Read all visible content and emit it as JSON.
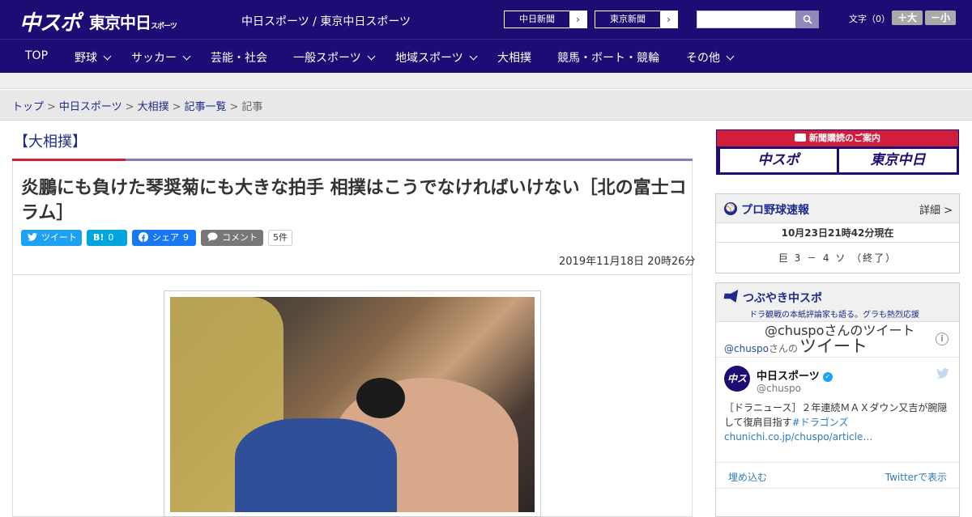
{
  "header": {
    "logo_chuspo": "中スポ",
    "logo_tokyo": "東京中日",
    "logo_tokyo_small": "スポーツ",
    "site_title": "中日スポーツ / 東京中日スポーツ",
    "paper_buttons": [
      "中日新聞",
      "東京新聞"
    ],
    "font_size_label": "文字（0）",
    "font_larger": "＋大",
    "font_smaller": "－小"
  },
  "nav": {
    "items": [
      {
        "label": "TOP",
        "dropdown": false
      },
      {
        "label": "野球",
        "dropdown": true
      },
      {
        "label": "サッカー",
        "dropdown": true
      },
      {
        "label": "芸能・社会",
        "dropdown": false
      },
      {
        "label": "一般スポーツ",
        "dropdown": true
      },
      {
        "label": "地域スポーツ",
        "dropdown": true
      },
      {
        "label": "大相撲",
        "dropdown": false
      },
      {
        "label": "競馬・ボート・競輪",
        "dropdown": false
      },
      {
        "label": "その他",
        "dropdown": true
      }
    ]
  },
  "breadcrumb": {
    "items": [
      "トップ",
      "中日スポーツ",
      "大相撲",
      "記事一覧"
    ],
    "current": "記事",
    "separator": ">"
  },
  "article": {
    "section": "【大相撲】",
    "headline": "炎鵬にも負けた琴奨菊にも大きな拍手 相撲はこうでなければいけない［北の富士コラム］",
    "share": {
      "tweet_label": "ツイート",
      "hatena_label": "B!",
      "hatena_count": "0",
      "facebook_label": "シェア",
      "facebook_count": "9",
      "comment_label": "コメント",
      "comment_count": "5件"
    },
    "date": "2019年11月18日 20時26分"
  },
  "sidebar": {
    "promo_head": "新聞購読のご案内",
    "promo_logos": [
      "中スポ",
      "東京中日"
    ],
    "baseball": {
      "title": "プロ野球速報",
      "more": "詳細 >",
      "time": "10月23日21時42分現在",
      "score": "巨 3 － 4 ソ （終了）"
    },
    "tsubuyaki": {
      "title": "つぶやき中スポ",
      "subtitle": "ドラ観戦の本紙評論家も語る。グラも熱烈応援",
      "timeline_handle": "@chuspo",
      "timeline_handle_suffix": "さんの",
      "timeline_word": "ツイート",
      "tweet": {
        "avatar": "中スポ",
        "name": "中日スポーツ",
        "user": "@chuspo",
        "text": "［ドラニュース］２年連続ＭＡＸダウン又吉が腕隠して復肩目指す",
        "hashtag": "#ドラゴンズ",
        "link": "chunichi.co.jp/chuspo/article…"
      },
      "embed_label": "埋め込む",
      "view_label": "Twitterで表示",
      "more_tweets": "@chuspoさんのツイート"
    }
  },
  "colors": {
    "header_bg": "#1d0c74",
    "accent_red": "#d21e3c",
    "twitter_blue": "#1da1f2",
    "facebook_blue": "#1877f2"
  }
}
